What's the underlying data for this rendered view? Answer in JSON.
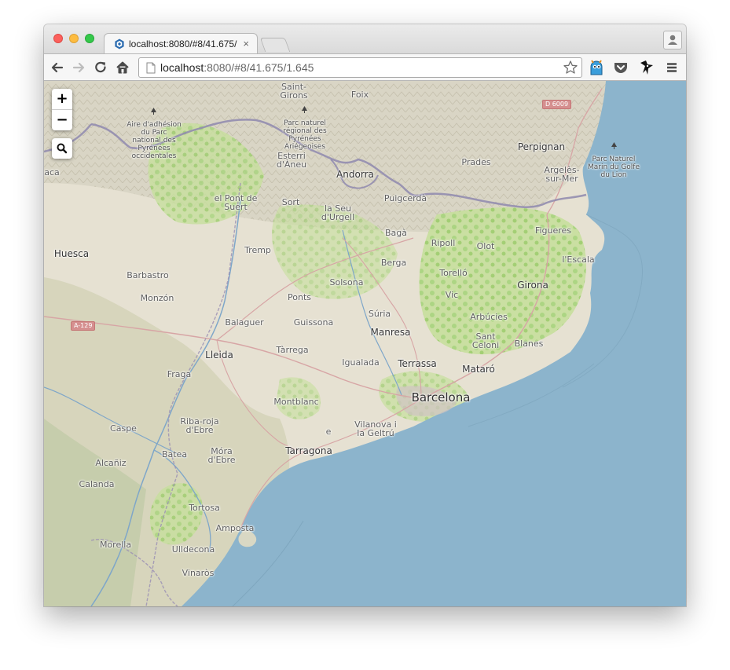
{
  "browser": {
    "tab_title": "localhost:8080/#8/41.675/",
    "tab_close": "×",
    "url_host": "localhost",
    "url_rest": ":8080/#8/41.675/1.645"
  },
  "map_controls": {
    "zoom_in": "+",
    "zoom_out": "−"
  },
  "colors": {
    "sea": "#8cb4cc",
    "land": "#e8e2d5",
    "forest": "#a8d57a",
    "border": "#8e88ae",
    "road": "#d7a5a5"
  },
  "map": {
    "road_shields": {
      "d6009": "D 6009",
      "a129": "A-129"
    },
    "parks": {
      "aire_adhesion": [
        "Aire d'adhésion",
        "du Parc",
        "national des",
        "Pyrénées",
        "occidentales"
      ],
      "parc_pyrenees_ariegeoises": [
        "Parc naturel",
        "régional des",
        "Pyrénées",
        "Ariégeoises"
      ],
      "parc_golfe_lion": [
        "Parc Naturel",
        "Marin du Golfe",
        "du Lion"
      ]
    },
    "places": {
      "saint_girons": [
        "Saint-",
        "Girons"
      ],
      "foix": "Foix",
      "perpignan": "Perpignan",
      "esterri": [
        "Esterri",
        "d'Àneu"
      ],
      "andorra": "Andorra",
      "prades": "Prades",
      "argeles": [
        "Argelès-",
        "sur-Mer"
      ],
      "aca": "aca",
      "pont_de_suert": [
        "el Pont de",
        "Suert"
      ],
      "sort": "Sort",
      "seu_urgell": [
        "la Seu",
        "d'Urgell"
      ],
      "puigcerda": "Puigcerdà",
      "figueres": "Figueres",
      "huesca": "Huesca",
      "baga": "Bagà",
      "tremp": "Tremp",
      "ripoll": "Ripoll",
      "olot": "Olot",
      "lescala": "l'Escala",
      "berga": "Berga",
      "barbastro": "Barbastro",
      "torello": "Torelló",
      "solsona": "Solsona",
      "girona": "Girona",
      "monzon": "Monzón",
      "ponts": "Ponts",
      "vic": "Vic",
      "suria": "Súria",
      "arbucies": "Arbúcies",
      "balaguer": "Balaguer",
      "guissona": "Guissona",
      "manresa": "Manresa",
      "sant_celoni": [
        "Sant",
        "Celoni"
      ],
      "blanes": "Blanes",
      "tarrega": "Tàrrega",
      "lleida": "Lleida",
      "igualada": "Igualada",
      "terrassa": "Terrassa",
      "mataro": "Mataró",
      "fraga": "Fraga",
      "montblanc": "Montblanc",
      "barcelona": "Barcelona",
      "caspe": "Caspe",
      "riba_roja": [
        "Riba-roja",
        "d'Ebre"
      ],
      "vilanova": [
        "Vilanova i",
        "la Geltrú"
      ],
      "e": "e",
      "batea": "Batea",
      "mora": [
        "Móra",
        "d'Ebre"
      ],
      "tarragona": "Tarragona",
      "alcaniz": "Alcañiz",
      "calanda": "Calanda",
      "tortosa": "Tortosa",
      "amposta": "Amposta",
      "morella": "Morella",
      "ulldecona": "Ulldecona",
      "vinaros": "Vinaròs"
    }
  }
}
